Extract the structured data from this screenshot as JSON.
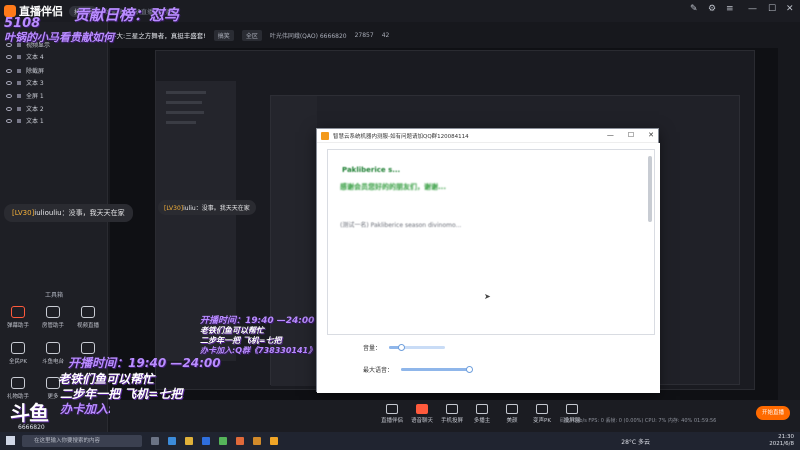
{
  "app": {
    "logo_text": "直播伴侣",
    "badge": "抖音版",
    "top_note": "如何获得手机直播视频播放?"
  },
  "liveinfo": {
    "title": "斗大:三星之方舞者，真挺丰盛套!",
    "tag": "搞笑",
    "category": "全区",
    "room": "叶光伟同峨(QAO) 6666820",
    "viewers": "27857",
    "likes": "42"
  },
  "sources": [
    {
      "label": "视频显示"
    },
    {
      "label": "文本 4"
    },
    {
      "label": "除截屏"
    },
    {
      "label": "文本 3"
    },
    {
      "label": "全屏 1"
    },
    {
      "label": "文本 2"
    },
    {
      "label": "文本 1"
    }
  ],
  "tools": {
    "title": "工具箱",
    "items": [
      {
        "label": "弹幕助手"
      },
      {
        "label": "房管助手"
      },
      {
        "label": "视频直播"
      },
      {
        "label": "全民PK"
      },
      {
        "label": "斗鱼电台"
      },
      {
        "label": "连麦"
      },
      {
        "label": "礼物助手"
      },
      {
        "label": "更多"
      }
    ]
  },
  "chat": {
    "message1_level": "[LV30]",
    "message1_text": "iuliouliu：没事，我天天在家",
    "message2_level": "[LV30]",
    "message2_text": "iuliu：没事。我天天在家"
  },
  "overlays": {
    "rank_title": "贡献日榜：怼鸟",
    "rank_number": "5108",
    "rank_sub": "叶锅的小马看贵献如何",
    "time": "开播时间：19:40 —24:00",
    "text_a": "老铁们鱼可以帮忙",
    "text_b": "二步年一把 飞机=七把",
    "join": "办卡加入:Q群《738330141》",
    "douyu_logo": "斗鱼",
    "douyu_id": "6666820"
  },
  "dialog": {
    "title": "智慧云系统机器内测服-如有问题请加QQ群120084114",
    "minimize": "—",
    "maximize": "☐",
    "close": "✕",
    "line1": "Pakliberice s...",
    "line2": "感谢会员您好的的朋友们，谢谢...",
    "line3": "(测试一名) Pakliberice season divinomo...",
    "volume_label": "音量：",
    "max_label": "最大语音：",
    "volume_level": 0.22,
    "max_level": 0.98
  },
  "bottombar": {
    "buttons": [
      {
        "label": "直播伴侣"
      },
      {
        "label": "语音聊天"
      },
      {
        "label": "手机投屏"
      },
      {
        "label": "多播主"
      },
      {
        "label": "美颜"
      },
      {
        "label": "变声PK"
      },
      {
        "label": "投屏器"
      }
    ],
    "start_label": "开始直播",
    "status": "码率: 0kb/s  FPS: 0  丢帧: 0 (0.00%)  CPU: 7%  内存: 40%  01:59:56"
  },
  "taskbar": {
    "search_placeholder": "在这里输入你要搜索的内容",
    "weather": "28°C 多云",
    "time": "21:30",
    "date": "2021/6/8"
  }
}
